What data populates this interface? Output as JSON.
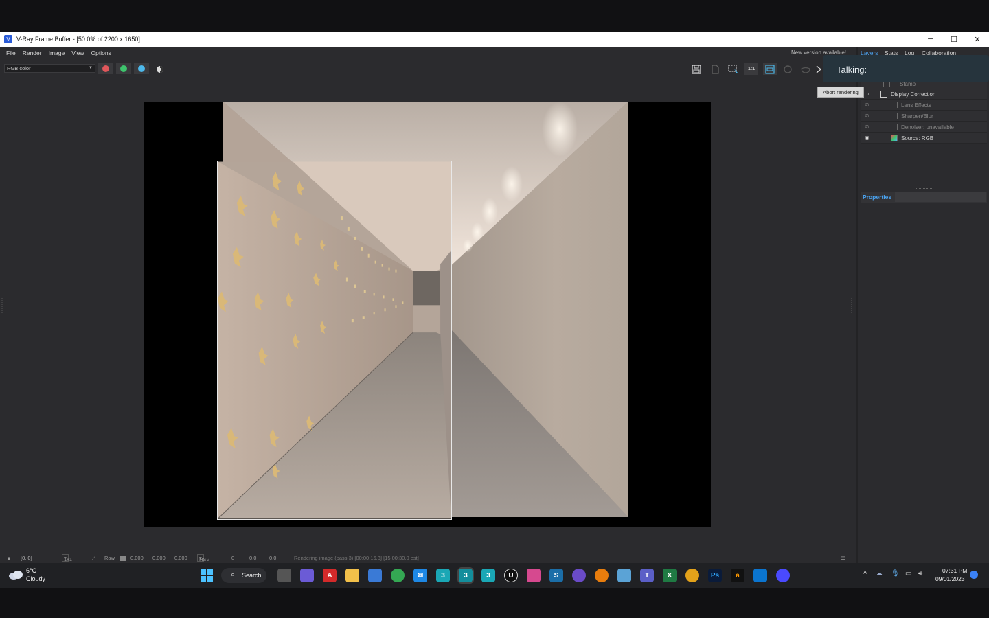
{
  "window": {
    "title": "V-Ray Frame Buffer - [50.0% of 2200 x 1650]",
    "minimize_glyph": "─",
    "maximize_glyph": "☐",
    "close_glyph": "✕"
  },
  "menu": {
    "items": [
      "File",
      "Render",
      "Image",
      "View",
      "Options"
    ],
    "new_version": "New version available!"
  },
  "toolbar": {
    "channel": "RGB color",
    "channel_buttons": [
      {
        "name": "red-channel",
        "color": "#e0575b"
      },
      {
        "name": "green-channel",
        "color": "#3ec46d"
      },
      {
        "name": "blue-channel",
        "color": "#4db8ea"
      }
    ],
    "zoom_badge": "1:1"
  },
  "right_panel": {
    "tabs": [
      "Layers",
      "Stats",
      "Log",
      "Collaboration"
    ],
    "layers": [
      {
        "label": "Stamp",
        "visible": false
      },
      {
        "label": "Display Correction",
        "visible": false
      },
      {
        "label": "Lens Effects",
        "visible": false
      },
      {
        "label": "Sharpen/Blur",
        "visible": false
      },
      {
        "label": "Denoiser: unavailable",
        "visible": false
      },
      {
        "label": "Source: RGB",
        "visible": true
      }
    ],
    "properties_label": "Properties"
  },
  "overlay": {
    "talking": "Talking:",
    "tooltip": "Abort rendering"
  },
  "statusbar": {
    "coords": "[0, 0]",
    "ratio": "1x1",
    "raw_label": "Raw",
    "raw_values": [
      "0.000",
      "0.000",
      "0.000"
    ],
    "color_space": "HSV",
    "hsv_values": [
      "0",
      "0.0",
      "0.0"
    ],
    "message": "Rendering image (pass 3) [00:00:16.3] [15:00:30.0 est]"
  },
  "taskbar": {
    "weather_temp": "6°C",
    "weather_condition": "Cloudy",
    "search_label": "Search",
    "time": "07:31 PM",
    "date": "09/01/2023"
  }
}
